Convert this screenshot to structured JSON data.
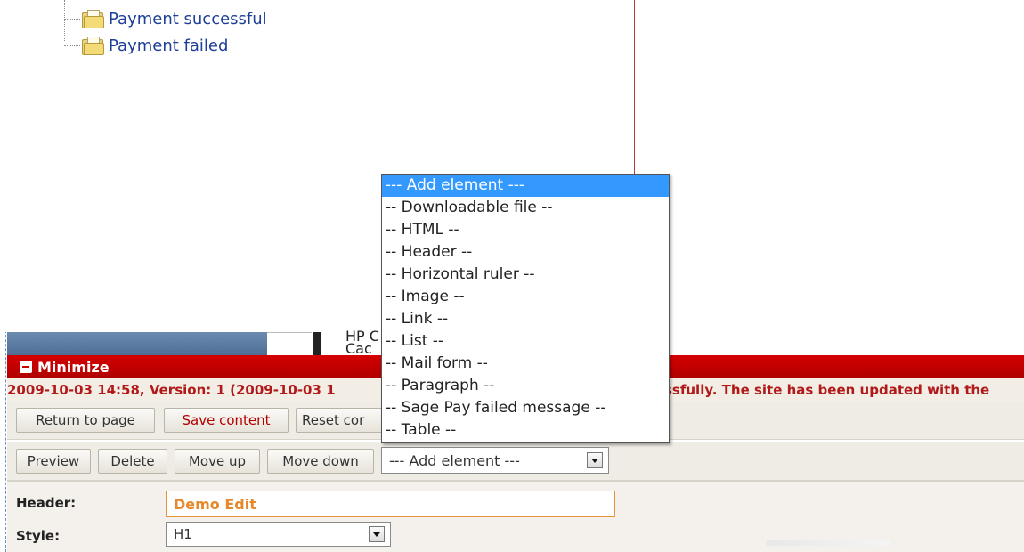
{
  "tree": {
    "items": [
      {
        "label": "Payment successful"
      },
      {
        "label": "Payment failed"
      }
    ]
  },
  "strip": {
    "partial_text": "HP C Cac"
  },
  "minimize": {
    "label": "Minimize"
  },
  "status": {
    "left_text": "2009-10-03 14:58, Version: 1 (2009-10-03 1",
    "right_text": "ssfully. The site has been updated with the"
  },
  "toolbar1": {
    "return_label": "Return to page",
    "save_label": "Save content",
    "reset_label": "Reset cor"
  },
  "toolbar2": {
    "preview_label": "Preview",
    "delete_label": "Delete",
    "move_up_label": "Move up",
    "move_down_label": "Move down",
    "add_element_value": "--- Add element ---"
  },
  "dropdown": {
    "options": [
      {
        "label": "--- Add element ---",
        "selected": true
      },
      {
        "label": "-- Downloadable file --"
      },
      {
        "label": "-- HTML --"
      },
      {
        "label": "-- Header --"
      },
      {
        "label": "-- Horizontal ruler --"
      },
      {
        "label": "-- Image --"
      },
      {
        "label": "-- Link --"
      },
      {
        "label": "-- List --"
      },
      {
        "label": "-- Mail form --"
      },
      {
        "label": "-- Paragraph --"
      },
      {
        "label": "-- Sage Pay failed message --"
      },
      {
        "label": "-- Table --"
      }
    ]
  },
  "form": {
    "header_label": "Header:",
    "header_value": "Demo Edit",
    "style_label": "Style:",
    "style_value": "H1"
  },
  "colors": {
    "accent_red": "#c00000",
    "link_blue": "#1d3f99",
    "selection_blue": "#3399ff",
    "input_orange": "#e6892a"
  }
}
